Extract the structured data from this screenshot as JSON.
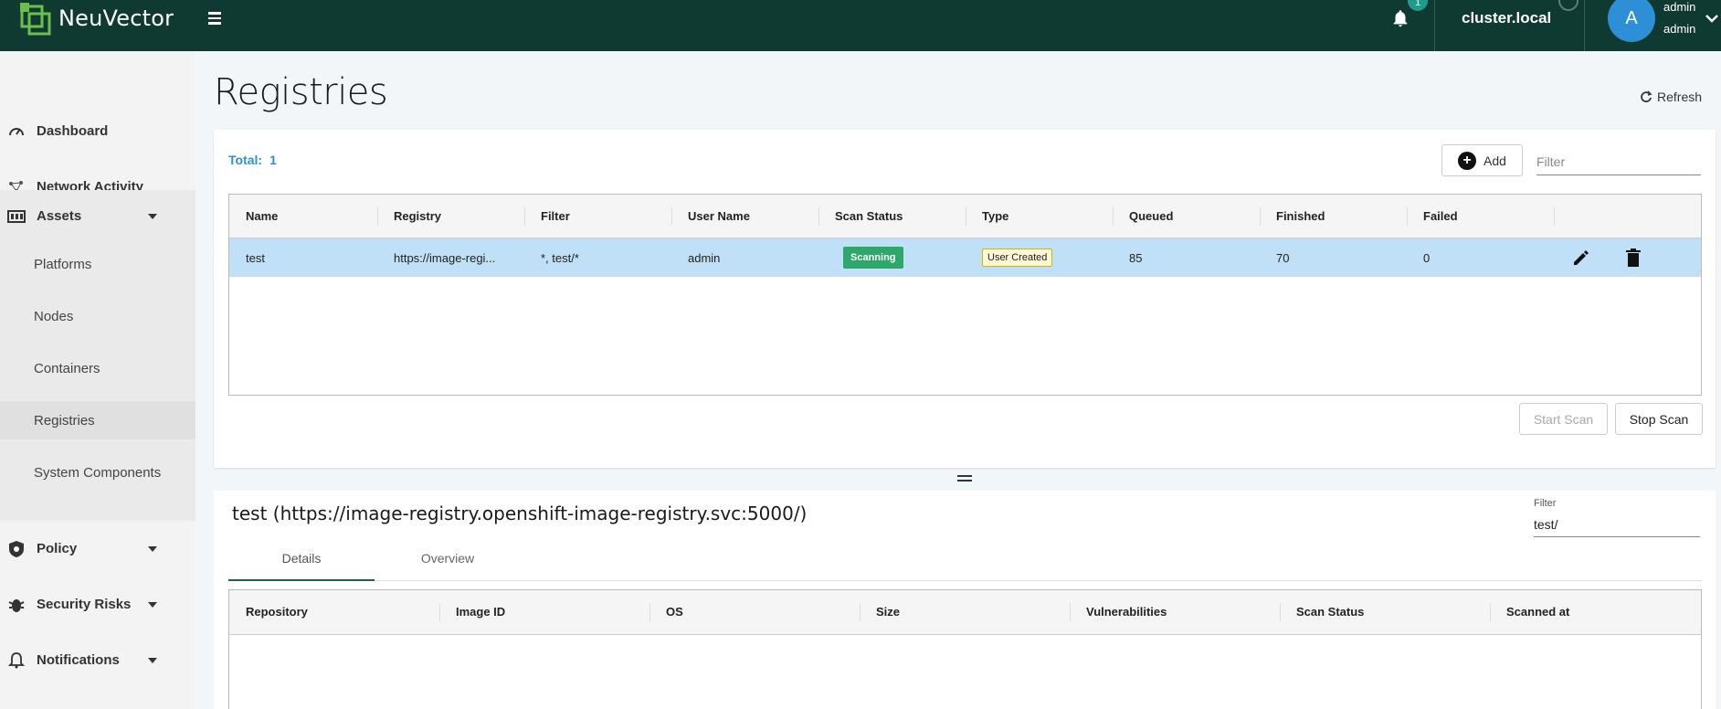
{
  "app": {
    "name": "NeuVector",
    "notification_count": "1",
    "cluster": "cluster.local",
    "avatar_letter": "A",
    "user_name": "admin",
    "user_role": "admin"
  },
  "sidebar": {
    "items": [
      {
        "label": "Dashboard",
        "icon": "speedometer-icon"
      },
      {
        "label": "Network Activity",
        "icon": "network-icon"
      },
      {
        "label": "Assets",
        "icon": "assets-icon"
      },
      {
        "label": "Policy",
        "icon": "shield-icon"
      },
      {
        "label": "Security Risks",
        "icon": "bug-icon"
      },
      {
        "label": "Notifications",
        "icon": "bell-icon"
      }
    ],
    "assets_sub": [
      "Platforms",
      "Nodes",
      "Containers",
      "Registries",
      "System Components"
    ]
  },
  "page": {
    "title": "Registries",
    "refresh_label": "Refresh"
  },
  "registries": {
    "total_label": "Total:",
    "total_value": "1",
    "add_label": "Add",
    "filter_placeholder": "Filter",
    "columns": [
      "Name",
      "Registry",
      "Filter",
      "User Name",
      "Scan Status",
      "Type",
      "Queued",
      "Finished",
      "Failed"
    ],
    "rows": [
      {
        "name": "test",
        "registry": "https://image-regi...",
        "filter": "*, test/*",
        "user_name": "admin",
        "scan_status": "Scanning",
        "type": "User Created",
        "queued": "85",
        "finished": "70",
        "failed": "0"
      }
    ],
    "start_scan_label": "Start Scan",
    "stop_scan_label": "Stop Scan"
  },
  "detail": {
    "title": "test (https://image-registry.openshift-image-registry.svc:5000/)",
    "filter_label": "Filter",
    "filter_value": "test/",
    "tabs": [
      "Details",
      "Overview"
    ],
    "columns": [
      "Repository",
      "Image ID",
      "OS",
      "Size",
      "Vulnerabilities",
      "Scan Status",
      "Scanned at"
    ]
  },
  "colors": {
    "topbar": "#0f3a31",
    "accent": "#2d8fd6",
    "row_selected": "#bfe0f7",
    "scanning_badge": "#2ea86a"
  }
}
